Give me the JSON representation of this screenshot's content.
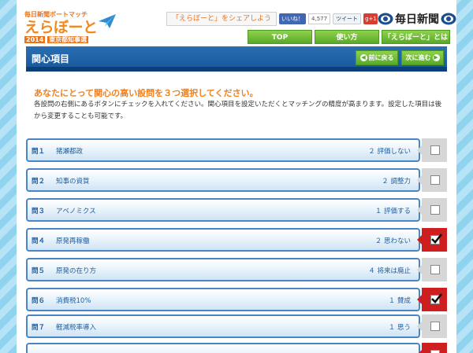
{
  "header": {
    "logo_small": "毎日新聞ボートマッチ",
    "logo_big": "えらぼーと",
    "logo_year": "2014",
    "logo_election": "東京都知事選",
    "share_text": "「えらぼーと」をシェアしよう",
    "fb_like": "いいね！",
    "fb_count": "4,577",
    "tweet": "ツイート",
    "gplus": "g+1",
    "brand": "毎日新聞"
  },
  "nav": {
    "top": "TOP",
    "howto": "使い方",
    "about": "「えらぼーと」とは"
  },
  "title_bar": {
    "title": "関心項目",
    "prev": "前に戻る",
    "next": "次に進む"
  },
  "intro": {
    "heading": "あなたにとって関心の高い設問を３つ選択してください。",
    "description": "各設問の右側にあるボタンにチェックを入れてください。関心項目を設定いただくとマッチングの精度が高まります。設定した項目は後から変更することも可能です。"
  },
  "questions": [
    {
      "num": "問１",
      "label": "猪瀬都政",
      "answer": "２ 評価しない",
      "checked": false
    },
    {
      "num": "問２",
      "label": "知事の資質",
      "answer": "２ 調整力",
      "checked": false
    },
    {
      "num": "問３",
      "label": "アベノミクス",
      "answer": "１ 評価する",
      "checked": false
    },
    {
      "num": "問４",
      "label": "原発再稼働",
      "answer": "２ 思わない",
      "checked": true
    },
    {
      "num": "問５",
      "label": "原発の在り方",
      "answer": "４ 将来は廃止",
      "checked": false
    },
    {
      "num": "問６",
      "label": "消費税10%",
      "answer": "１ 賛成",
      "checked": true
    },
    {
      "num": "問７",
      "label": "軽減税率導入",
      "answer": "１ 思う",
      "checked": false
    },
    {
      "num": "",
      "label": "",
      "answer": "",
      "checked": true
    }
  ],
  "colors": {
    "accent_blue": "#1a5a9e",
    "nav_green": "#5aa82a",
    "check_red": "#cd1f1f",
    "heading_orange": "#f0801e"
  }
}
